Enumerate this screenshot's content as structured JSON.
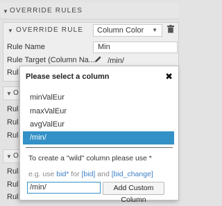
{
  "override_rules": {
    "title": "OVERRIDE RULES"
  },
  "override_rule": {
    "title": "OVERRIDE RULE",
    "type_value": "Column Color",
    "rows": [
      {
        "label": "Rule Name",
        "value": "Min"
      },
      {
        "label": "Rule Target (Column Na...",
        "value": "/min/"
      },
      {
        "label": "Rul"
      }
    ]
  },
  "background_groups": [
    {
      "title": "O",
      "rows": [
        "Rul",
        "Rul",
        "Rul"
      ]
    },
    {
      "title": "O",
      "rows": [
        "Rul",
        "Rul",
        "Rul"
      ]
    }
  ],
  "dialog": {
    "title": "Please select a column",
    "close_glyph": "✖",
    "options": [
      "minValEur",
      "maxValEur",
      "avgValEur",
      "/min/"
    ],
    "selected_index": 3,
    "hint": "To create a \"wild\" column please use *",
    "example": {
      "prefix": "e.g. use ",
      "wild": "bid*",
      "for": " for ",
      "bid": "[bid]",
      "and": " and ",
      "bid_change": "[bid_change]"
    },
    "custom_value": "/min/",
    "add_button": "Add Custom Column"
  },
  "colors": {
    "accent": "#3391c7",
    "link": "#3b7fc4"
  }
}
